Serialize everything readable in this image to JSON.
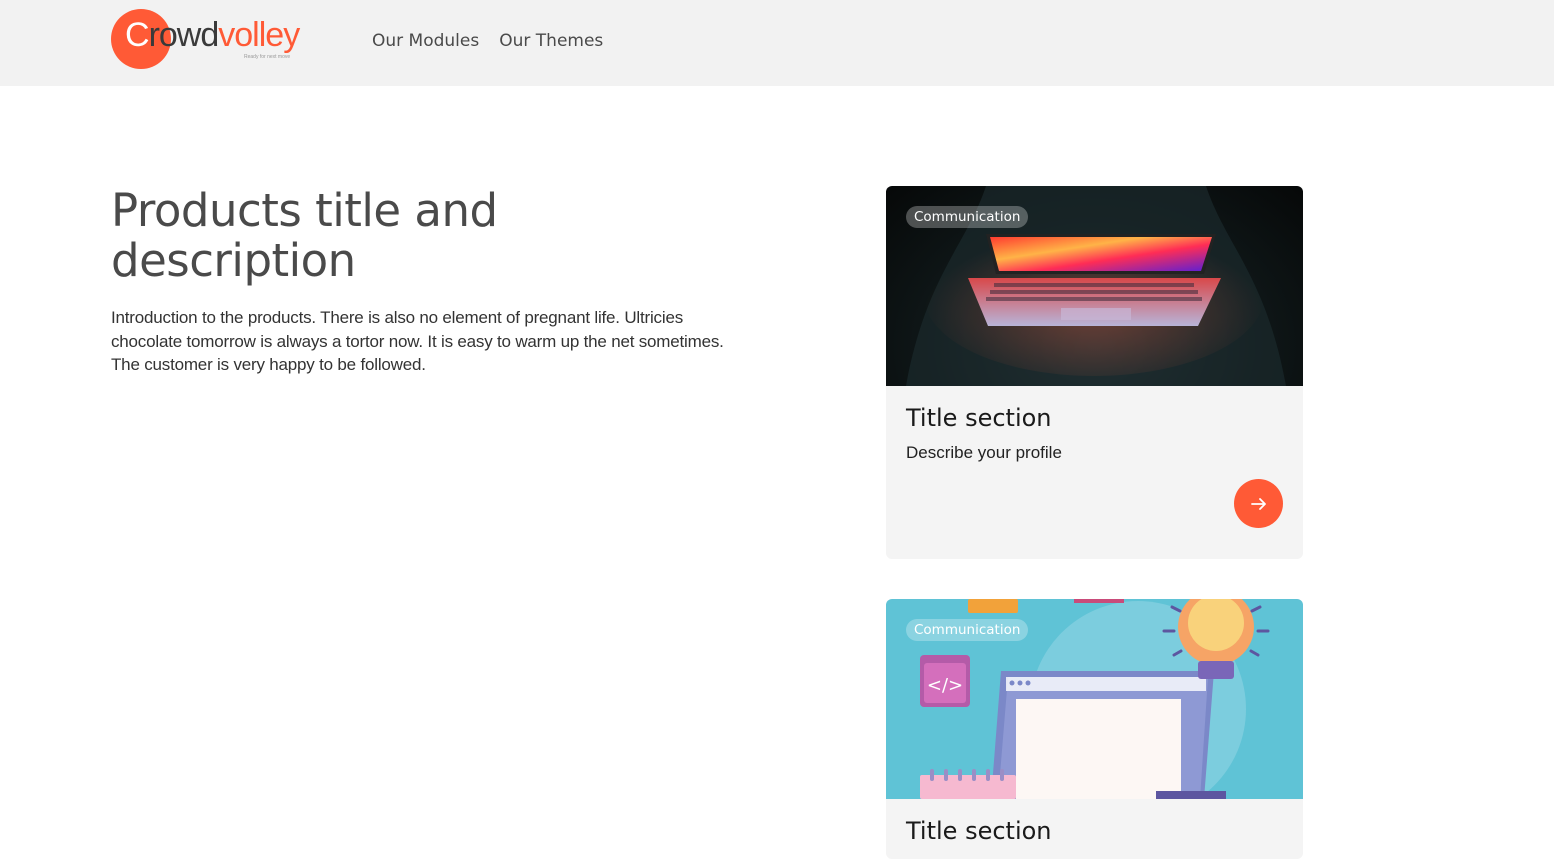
{
  "brand": {
    "logo_first": "C",
    "logo_mid": "rowd",
    "logo_end": "volley",
    "tagline": "Ready for next move",
    "accent": "#ff5a36"
  },
  "nav": {
    "items": [
      {
        "label": "Our Modules"
      },
      {
        "label": "Our Themes"
      }
    ]
  },
  "hero": {
    "title": "Products title and description",
    "description": "Introduction to the products. There is also no element of pregnant life. Ultricies chocolate tomorrow is always a tortor now. It is easy to warm up the net sometimes. The customer is very happy to be followed."
  },
  "cards": [
    {
      "badge": "Communication",
      "title": "Title section",
      "subtitle": "Describe your profile",
      "image": "laptop-photo",
      "action_icon": "arrow-right-icon"
    },
    {
      "badge": "Communication",
      "title": "Title section",
      "image": "coding-illustration"
    }
  ]
}
